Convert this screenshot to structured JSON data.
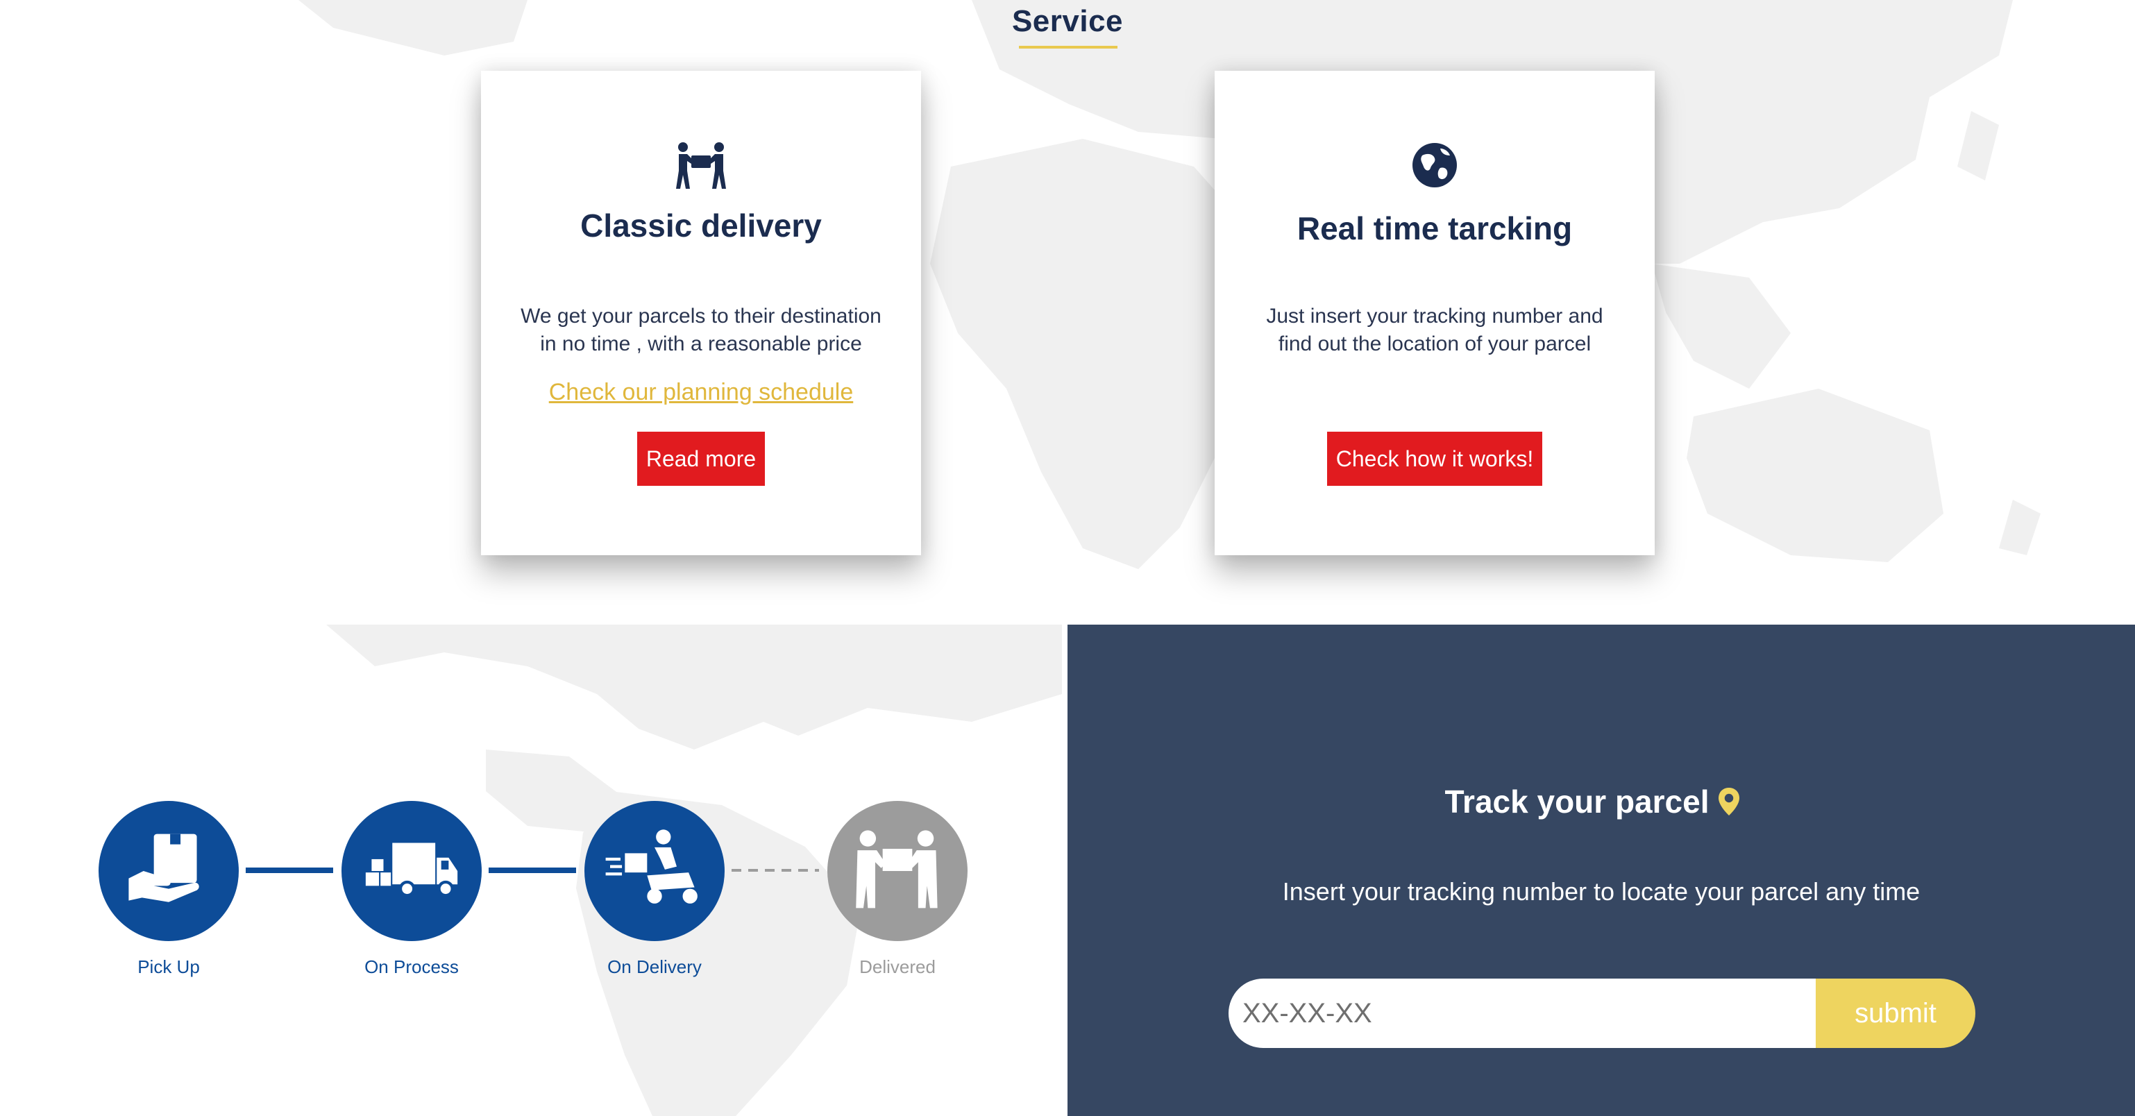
{
  "service": {
    "title": "Service",
    "accent_color": "#e9c94f"
  },
  "cards": [
    {
      "icon": "people-carrying-box-icon",
      "title": "Classic delivery",
      "text": "We get your parcels to their destination in no time , with a reasonable price",
      "link": "Check our planning schedule",
      "button": "Read more"
    },
    {
      "icon": "globe-icon",
      "title": "Real time tarcking",
      "text": "Just insert your tracking number and find out the location of your parcel",
      "button": "Check how it works!"
    }
  ],
  "process": {
    "steps": [
      {
        "label": "Pick Up",
        "icon": "hand-holding-box-icon",
        "status": "done"
      },
      {
        "label": "On Process",
        "icon": "delivery-truck-icon",
        "status": "done"
      },
      {
        "label": "On Delivery",
        "icon": "courier-scooter-icon",
        "status": "done"
      },
      {
        "label": "Delivered",
        "icon": "parcel-handover-icon",
        "status": "pending"
      }
    ],
    "active_color": "#0d4c98",
    "pending_color": "#9c9c9c"
  },
  "track": {
    "title": "Track your parcel",
    "title_icon": "location-pin-icon",
    "description": "Insert your tracking number to locate your parcel any time",
    "placeholder": "XX-XX-XX",
    "submit": "submit",
    "panel_color": "#364762",
    "submit_color": "#eed45f"
  },
  "colors": {
    "primary_text": "#1b2c4f",
    "button_red": "#e11b1f",
    "link_gold": "#e0b73c"
  }
}
